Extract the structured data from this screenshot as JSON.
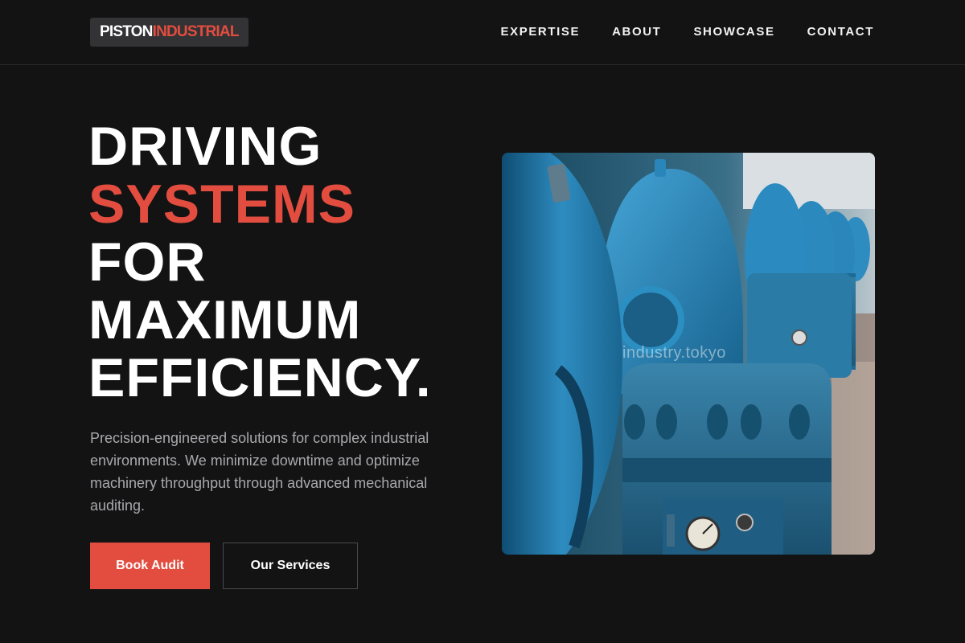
{
  "brand": {
    "name_part1": "PISTON",
    "name_part2": "INDUSTRIAL"
  },
  "nav": {
    "items": [
      {
        "label": "EXPERTISE"
      },
      {
        "label": "ABOUT"
      },
      {
        "label": "SHOWCASE"
      },
      {
        "label": "CONTACT"
      }
    ]
  },
  "hero": {
    "headline": {
      "line1": "DRIVING",
      "line2": "SYSTEMS",
      "line3": "FOR",
      "line4": "MAXIMUM",
      "line5": "EFFICIENCY."
    },
    "description": "Precision-engineered solutions for complex industrial environments. We minimize downtime and optimize machinery throughput through advanced mechanical auditing.",
    "primary_button": "Book Audit",
    "secondary_button": "Our Services",
    "image": {
      "subject": "blue industrial pumps in a row",
      "watermark": "industry.tokyo"
    }
  },
  "colors": {
    "background": "#131314",
    "accent": "#e24d3f",
    "text": "#ffffff",
    "muted_text": "#a9a9ad"
  }
}
